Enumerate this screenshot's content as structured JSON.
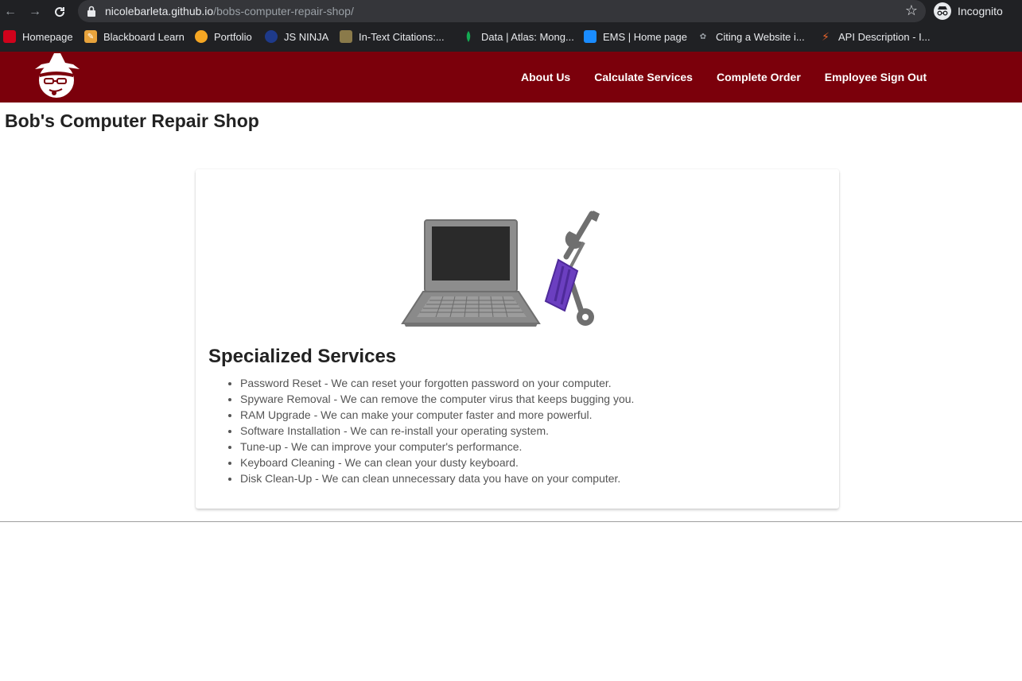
{
  "browser": {
    "url_host": "nicolebarleta.github.io",
    "url_path": "/bobs-computer-repair-shop/",
    "profile_label": "Incognito",
    "icons": {
      "back": "back-arrow-icon",
      "forward": "forward-arrow-icon",
      "reload": "reload-icon",
      "lock": "lock-icon",
      "bookmark": "star-icon",
      "profile": "incognito-icon"
    },
    "bookmarks": [
      {
        "label": "Homepage"
      },
      {
        "label": "Blackboard Learn"
      },
      {
        "label": "Portfolio"
      },
      {
        "label": "JS NINJA"
      },
      {
        "label": "In-Text Citations:..."
      },
      {
        "label": "Data | Atlas: Mong..."
      },
      {
        "label": "EMS | Home page"
      },
      {
        "label": "Citing a Website i..."
      },
      {
        "label": "API Description - I..."
      }
    ]
  },
  "site": {
    "brand_color": "#7b000b",
    "logo": "bob-logo-icon",
    "nav": [
      {
        "label": "About Us"
      },
      {
        "label": "Calculate Services"
      },
      {
        "label": "Complete Order"
      },
      {
        "label": "Employee Sign Out"
      }
    ]
  },
  "page": {
    "title": "Bob's Computer Repair Shop",
    "card": {
      "image": "laptop-and-tools-illustration",
      "title": "Specialized Services",
      "services": [
        "Password Reset - We can reset your forgotten password on your computer.",
        "Spyware Removal - We can remove the computer virus that keeps bugging you.",
        "RAM Upgrade - We can make your computer faster and more powerful.",
        "Software Installation - We can re-install your operating system.",
        "Tune-up - We can improve your computer's performance.",
        "Keyboard Cleaning - We can clean your dusty keyboard.",
        "Disk Clean-Up - We can clean unnecessary data you have on your computer."
      ]
    }
  }
}
